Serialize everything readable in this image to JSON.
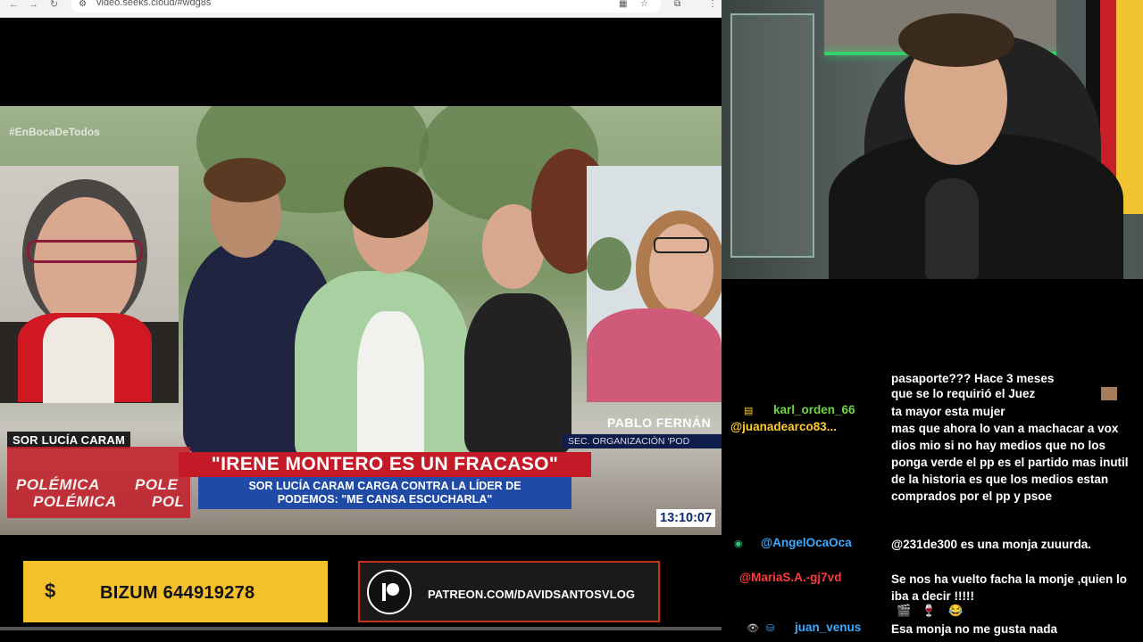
{
  "browser": {
    "url": "video.seeks.cloud/#wdg8s"
  },
  "video": {
    "hashtag": "#EnBocaDeTodos",
    "left_name": "SOR LUCÍA CARAM",
    "right_name": "PABLO FERNÁN",
    "right_role": "SEC. ORGANIZACIÓN 'POD",
    "headline": "\"IRENE MONTERO ES UN FRACASO\"",
    "subline_1": "SOR LUCÍA CARAM CARGA CONTRA LA LÍDER DE",
    "subline_2": "PODEMOS: \"ME CANSA ESCUCHARLA\"",
    "polemica": [
      "POLÉMICA",
      "POLE",
      "POLÉMICA",
      "POL"
    ],
    "clock": "13:10:07",
    "progress": 0.0
  },
  "banners": {
    "bizum_icon": "$",
    "bizum_text": "BIZUM 644919278",
    "patreon_text": "PATREON.COM/DAVIDSANTOSVLOG"
  },
  "colors": {
    "accent_red": "#c41927",
    "accent_blue": "#1f4ba7",
    "bizum_yellow": "#f4c12d",
    "user_green": "#6fd44a",
    "user_blue": "#3da9ff",
    "user_red": "#ff3b3b",
    "user_yellow": "#ffcc33"
  },
  "chat": {
    "top_partial": "pasaporte??? Hace 3 meses",
    "messages": [
      {
        "user": "",
        "text": "que se lo requirió el Juez",
        "color": "#ffffff",
        "emote": "face-emote"
      },
      {
        "user": "karl_orden_66",
        "text": "ta mayor esta mujer",
        "color": "#6fd44a",
        "badge": "bits-badge"
      },
      {
        "user": "@juanadearco83...",
        "text": "mas que ahora lo van a machacar a vox dios mio si no hay medios que no los ponga verde el pp es el partido mas inutil de la historia es que los medios estan comprados por el pp y psoe",
        "color": "#ffcc33"
      },
      {
        "user": "@AngelOcaOca",
        "text": "@231de300 es una monja zuuurda.",
        "color": "#3da9ff",
        "badge": "eye-badge"
      },
      {
        "user": "@MariaS.A.-gj7vd",
        "text": "Se nos ha vuelto facha la monje ,quien lo iba a decir !!!!!",
        "color": "#ff3b3b",
        "emotes": "movie-emote wine-emote laugh-emote"
      },
      {
        "user": "juan_venus",
        "text": "Esa monja no me gusta nada",
        "color": "#3da9ff",
        "badge": "eye-badge"
      }
    ]
  }
}
